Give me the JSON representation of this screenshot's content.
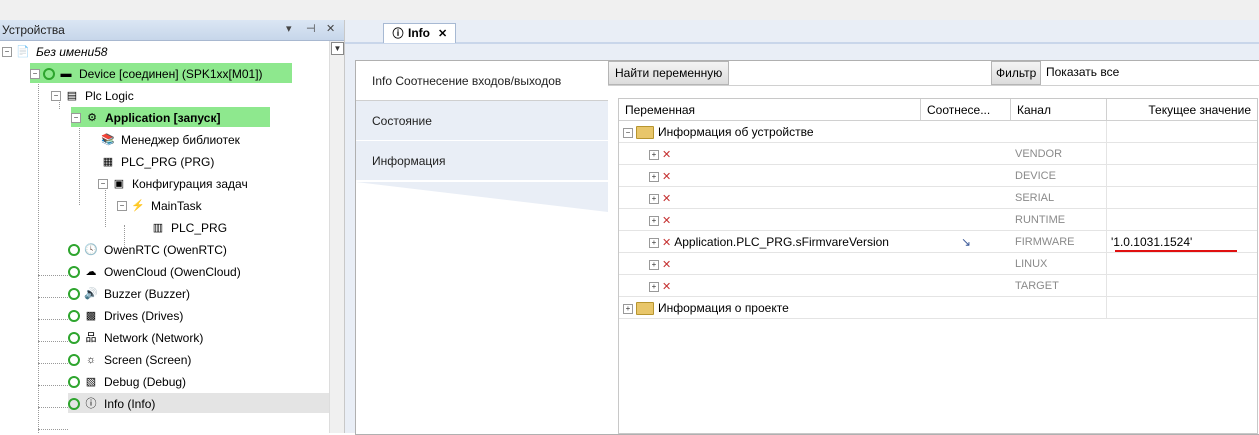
{
  "devices_panel": {
    "title": "Устройства",
    "header_buttons": [
      "▾",
      "⊣",
      "✕"
    ],
    "tree": [
      {
        "label": "Без имени58",
        "style": "italic",
        "icon": "project-icon"
      },
      {
        "label": "Device [соединен] (SPK1xx[M01])",
        "style": "normal",
        "icon": "device-icon",
        "highlight": true
      },
      {
        "label": "Plc Logic",
        "style": "normal",
        "icon": "plc-logic-icon"
      },
      {
        "label": "Application [запуск]",
        "style": "bold",
        "icon": "application-icon",
        "highlight": true
      },
      {
        "label": "Менеджер библиотек",
        "style": "normal",
        "icon": "library-manager-icon"
      },
      {
        "label": "PLC_PRG (PRG)",
        "style": "normal",
        "icon": "program-icon"
      },
      {
        "label": "Конфигурация задач",
        "style": "normal",
        "icon": "task-config-icon"
      },
      {
        "label": "MainTask",
        "style": "normal",
        "icon": "task-icon"
      },
      {
        "label": "PLC_PRG",
        "style": "normal",
        "icon": "program-call-icon"
      },
      {
        "label": "OwenRTC (OwenRTC)",
        "style": "normal",
        "icon": "clock-icon"
      },
      {
        "label": "OwenCloud (OwenCloud)",
        "style": "normal",
        "icon": "cloud-icon"
      },
      {
        "label": "Buzzer (Buzzer)",
        "style": "normal",
        "icon": "speaker-icon"
      },
      {
        "label": "Drives (Drives)",
        "style": "normal",
        "icon": "drives-icon"
      },
      {
        "label": "Network (Network)",
        "style": "normal",
        "icon": "network-icon"
      },
      {
        "label": "Screen (Screen)",
        "style": "normal",
        "icon": "screen-icon"
      },
      {
        "label": "Debug (Debug)",
        "style": "normal",
        "icon": "debug-icon"
      },
      {
        "label": "Info (Info)",
        "style": "normal",
        "icon": "info-icon",
        "selected": true
      }
    ]
  },
  "editor": {
    "tab_label": "Info",
    "side_tabs": [
      "Info Соотнесение входов/выходов",
      "Состояние",
      "Информация"
    ],
    "find_variable_label": "Найти переменную",
    "filter_label": "Фильтр",
    "filter_value": "Показать все",
    "columns": [
      "Переменная",
      "Соотнесе...",
      "Канал",
      "Текущее значение"
    ],
    "groups": [
      {
        "label": "Информация об устройстве",
        "rows": [
          {
            "variable": "",
            "channel": "VENDOR",
            "value": ""
          },
          {
            "variable": "",
            "channel": "DEVICE",
            "value": ""
          },
          {
            "variable": "",
            "channel": "SERIAL",
            "value": ""
          },
          {
            "variable": "",
            "channel": "RUNTIME",
            "value": ""
          },
          {
            "variable": "Application.PLC_PRG.sFirmvareVersion",
            "channel": "FIRMWARE",
            "value": "'1.0.1031.1524'",
            "mapped": true
          },
          {
            "variable": "",
            "channel": "LINUX",
            "value": ""
          },
          {
            "variable": "",
            "channel": "TARGET",
            "value": ""
          }
        ]
      },
      {
        "label": "Информация о проекте",
        "rows": []
      }
    ],
    "underline_color": "#e01010"
  }
}
